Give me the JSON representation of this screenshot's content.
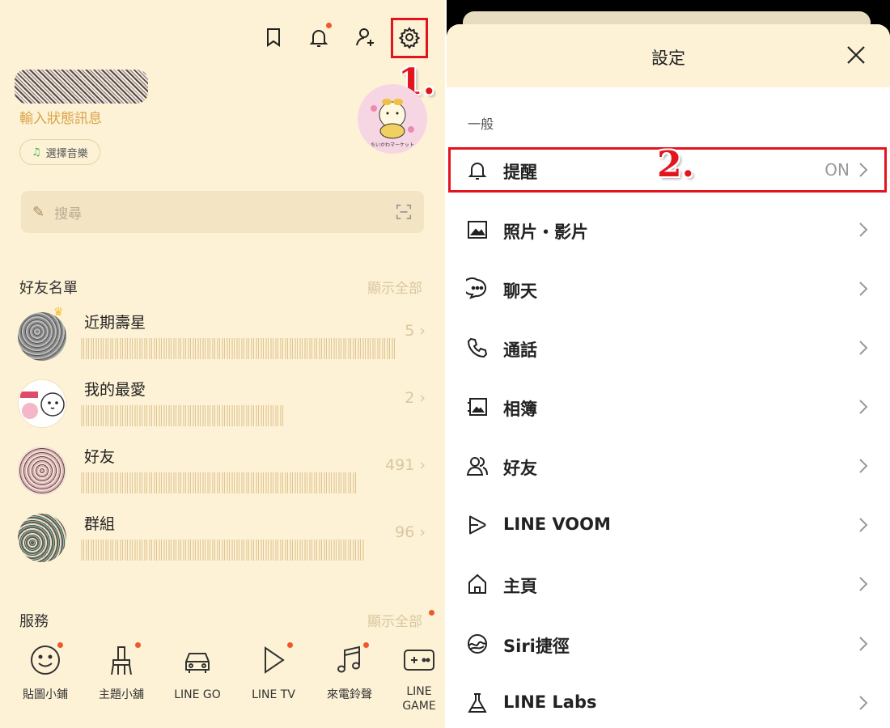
{
  "friends_tab": {
    "status_message": "輸入狀態訊息",
    "music_button": "選擇音樂",
    "search_placeholder": "搜尋",
    "friend_list_title": "好友名單",
    "friend_list_show_all": "顯示全部",
    "friend_groups": [
      {
        "name": "近期壽星",
        "count": "5"
      },
      {
        "name": "我的最愛",
        "count": "2"
      },
      {
        "name": "好友",
        "count": "491"
      },
      {
        "name": "群組",
        "count": "96"
      }
    ],
    "services_title": "服務",
    "services_show_all": "顯示全部",
    "services": [
      {
        "label": "貼圖小鋪",
        "icon": "smiley-icon"
      },
      {
        "label": "主題小舖",
        "icon": "brush-icon"
      },
      {
        "label": "LINE GO",
        "icon": "car-icon"
      },
      {
        "label": "LINE TV",
        "icon": "play-icon"
      },
      {
        "label": "來電鈴聲",
        "icon": "music-note-icon"
      },
      {
        "label": "LINE GAME",
        "icon": "gamepad-icon"
      }
    ],
    "avatar_caption": "ちいかわマーケット",
    "step1_label": "1.",
    "step2_label": "2."
  },
  "settings": {
    "title": "設定",
    "group_general": "一般",
    "items": [
      {
        "label": "提醒",
        "value": "ON",
        "icon": "bell-icon"
      },
      {
        "label": "照片・影片",
        "value": "",
        "icon": "photo-icon"
      },
      {
        "label": "聊天",
        "value": "",
        "icon": "chat-icon"
      },
      {
        "label": "通話",
        "value": "",
        "icon": "phone-icon"
      },
      {
        "label": "相簿",
        "value": "",
        "icon": "album-icon"
      },
      {
        "label": "好友",
        "value": "",
        "icon": "friends-icon"
      },
      {
        "label": "LINE VOOM",
        "value": "",
        "icon": "voom-icon"
      },
      {
        "label": "主頁",
        "value": "",
        "icon": "home-icon"
      },
      {
        "label": "Siri捷徑",
        "value": "",
        "icon": "siri-icon"
      },
      {
        "label": "LINE Labs",
        "value": "",
        "icon": "flask-icon"
      }
    ]
  },
  "colors": {
    "background_cream": "#fdf2d5",
    "highlight_red": "#e3141d",
    "badge_orange": "#f0572b"
  }
}
